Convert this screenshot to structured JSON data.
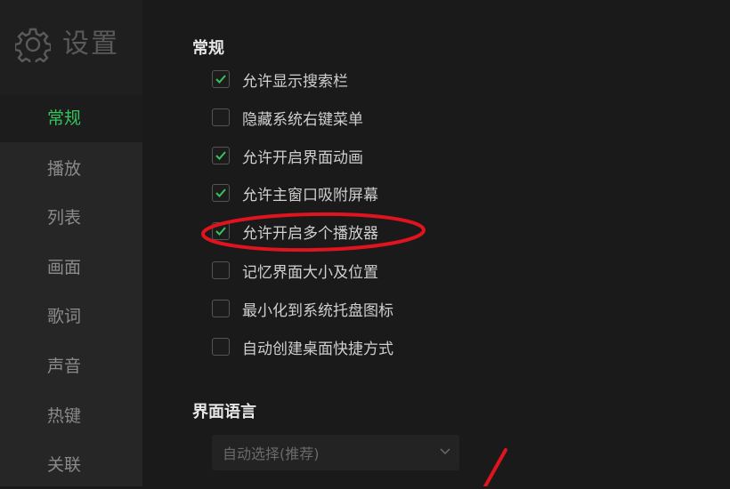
{
  "sidebar": {
    "title": "设置",
    "items": [
      {
        "label": "常规",
        "active": true
      },
      {
        "label": "播放",
        "active": false
      },
      {
        "label": "列表",
        "active": false
      },
      {
        "label": "画面",
        "active": false
      },
      {
        "label": "歌词",
        "active": false
      },
      {
        "label": "声音",
        "active": false
      },
      {
        "label": "热键",
        "active": false
      },
      {
        "label": "关联",
        "active": false
      }
    ]
  },
  "main": {
    "general_title": "常规",
    "options": [
      {
        "label": "允许显示搜索栏",
        "checked": true
      },
      {
        "label": "隐藏系统右键菜单",
        "checked": false
      },
      {
        "label": "允许开启界面动画",
        "checked": true
      },
      {
        "label": "允许主窗口吸附屏幕",
        "checked": true
      },
      {
        "label": "允许开启多个播放器",
        "checked": true
      },
      {
        "label": "记忆界面大小及位置",
        "checked": false
      },
      {
        "label": "最小化到系统托盘图标",
        "checked": false
      },
      {
        "label": "自动创建桌面快捷方式",
        "checked": false
      }
    ],
    "language_title": "界面语言",
    "language_select": {
      "value": "自动选择(推荐)"
    }
  },
  "colors": {
    "accent_green": "#36c25c",
    "annotation_red": "#e0141e",
    "background": "#1a1a1a",
    "sidebar": "#262626"
  }
}
